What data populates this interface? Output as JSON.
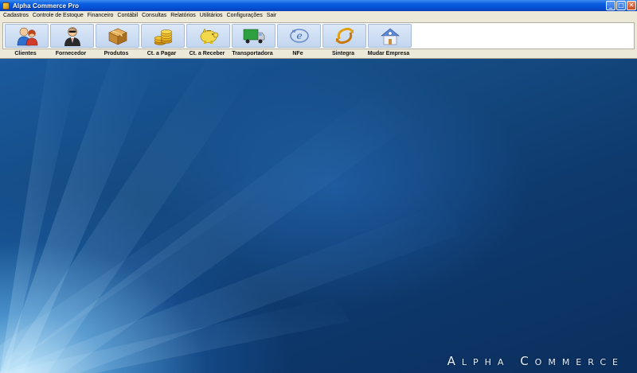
{
  "window": {
    "title": "Alpha Commerce Pro",
    "controls": {
      "minimize": "_",
      "maximize": "□",
      "close": "✕"
    }
  },
  "menu": [
    "Cadastros",
    "Controle de Estoque",
    "Financeiro",
    "Contábil",
    "Consultas",
    "Relatórios",
    "Utilitários",
    "Configurações",
    "Sair"
  ],
  "toolbar": {
    "buttons": [
      {
        "label": "Clientes",
        "icon": "users-icon",
        "dropdown": false
      },
      {
        "label": "Fornecedor",
        "icon": "supplier-person-icon",
        "dropdown": false
      },
      {
        "label": "Produtos",
        "icon": "product-box-icon",
        "dropdown": false
      },
      {
        "label": "Ct. a Pagar",
        "icon": "coins-icon",
        "dropdown": true
      },
      {
        "label": "Ct. a Receber",
        "icon": "piggy-bank-icon",
        "dropdown": true
      },
      {
        "label": "Transportadora",
        "icon": "truck-icon",
        "dropdown": false
      },
      {
        "label": "NFe",
        "icon": "nfe-icon",
        "dropdown": true
      },
      {
        "label": "Sintegra",
        "icon": "sync-arrows-icon",
        "dropdown": false
      },
      {
        "label": "Mudar Empresa",
        "icon": "house-icon",
        "dropdown": false
      }
    ]
  },
  "desktop": {
    "brand": "Alpha Commerce"
  },
  "colors": {
    "titlebar": "#0550d6",
    "menubar": "#ece9d8",
    "desktop_dark": "#0b2f5e",
    "desktop_light": "#b4e6ff"
  }
}
